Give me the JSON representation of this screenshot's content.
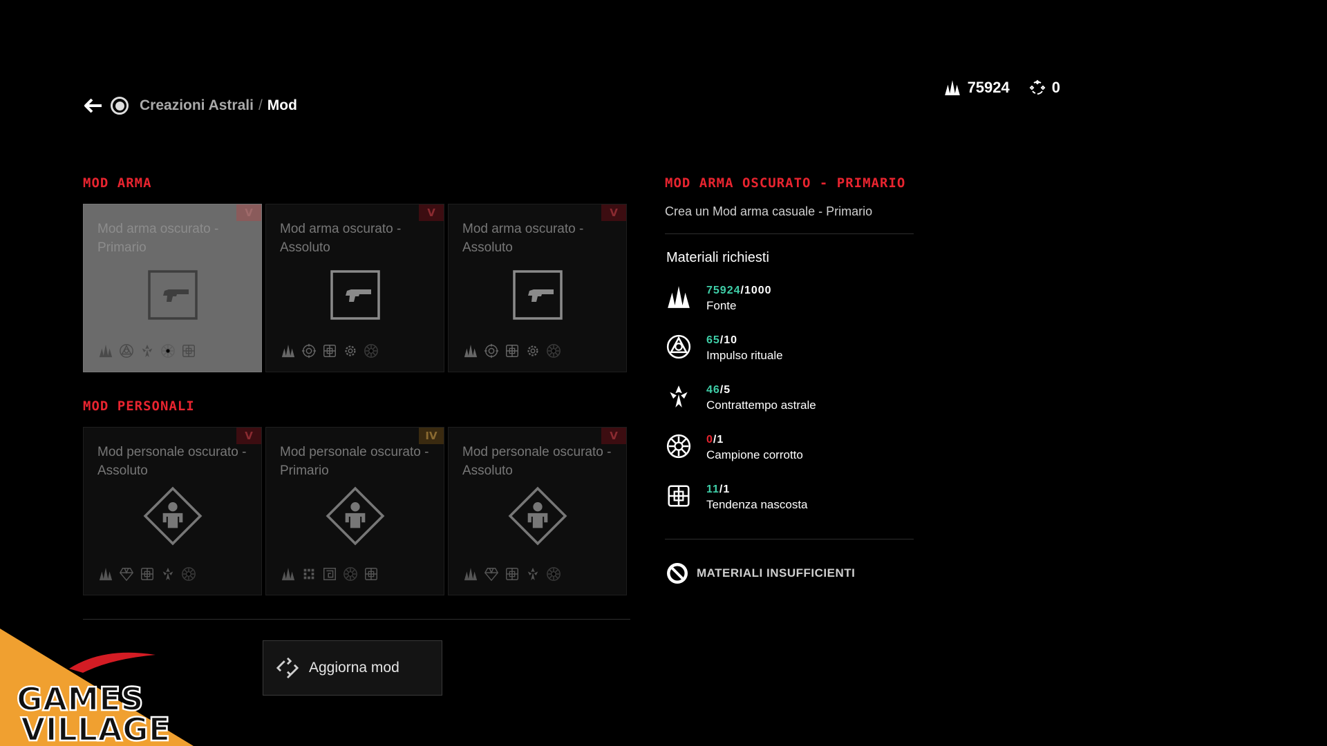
{
  "header": {
    "crumb_parent": "Creazioni Astrali",
    "crumb_sep": "/",
    "crumb_current": "Mod",
    "back_icon": "back-arrow-icon",
    "home_icon": "ring-icon"
  },
  "currency": {
    "fonte_amount": "75924",
    "glimmer_amount": "0"
  },
  "sections": {
    "weapon_title": "MOD ARMA",
    "personal_title": "MOD PERSONALI"
  },
  "weapon_cards": [
    {
      "title": "Mod arma oscurato - Primario",
      "tier": "V",
      "selected": true
    },
    {
      "title": "Mod arma oscurato - Assoluto",
      "tier": "V",
      "selected": false
    },
    {
      "title": "Mod arma oscurato - Assoluto",
      "tier": "V",
      "selected": false
    }
  ],
  "personal_cards": [
    {
      "title": "Mod personale oscurato - Assoluto",
      "tier": "V"
    },
    {
      "title": "Mod personale oscurato - Primario",
      "tier": "IV"
    },
    {
      "title": "Mod personale oscurato - Assoluto",
      "tier": "V"
    }
  ],
  "update_button": {
    "label": "Aggiorna mod"
  },
  "panel": {
    "title": "MOD ARMA OSCURATO - PRIMARIO",
    "description": "Crea un Mod arma casuale - Primario",
    "materials_title": "Materiali richiesti",
    "materials": [
      {
        "have": "75924",
        "need": "/1000",
        "name": "Fonte",
        "sufficient": true
      },
      {
        "have": "65",
        "need": "/10",
        "name": "Impulso rituale",
        "sufficient": true
      },
      {
        "have": "46",
        "need": "/5",
        "name": "Contrattempo astrale",
        "sufficient": true
      },
      {
        "have": "0",
        "need": "/1",
        "name": "Campione corrotto",
        "sufficient": false
      },
      {
        "have": "11",
        "need": "/1",
        "name": "Tendenza nascosta",
        "sufficient": true
      }
    ],
    "status": "MATERIALI INSUFFICIENTI"
  },
  "colors": {
    "accent_red": "#e8242f",
    "have_green": "#3fcfa8",
    "watermark_orange": "#f0a030"
  }
}
